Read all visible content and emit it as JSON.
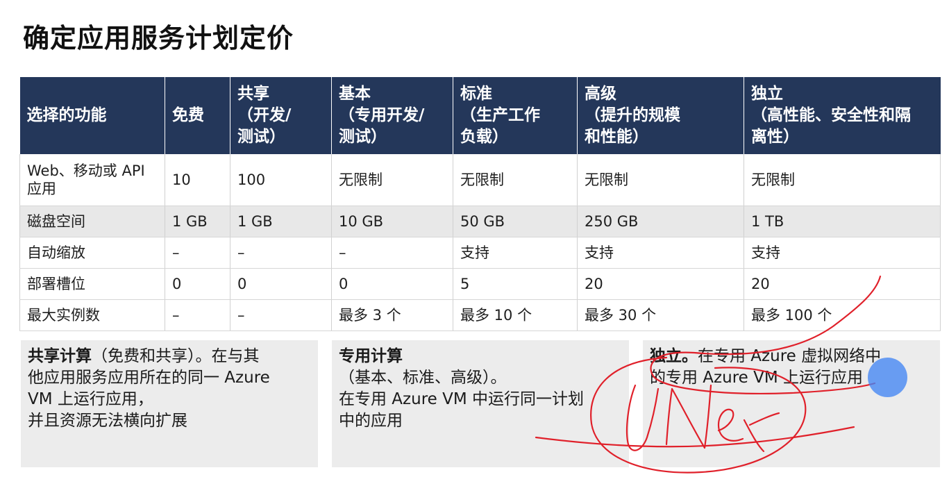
{
  "title": "确定应用服务计划定价",
  "table": {
    "headers": [
      [
        "选择的功能"
      ],
      [
        "免费"
      ],
      [
        "共享",
        "（开发/",
        "测试）"
      ],
      [
        "基本",
        "（专用开发/",
        "测试）"
      ],
      [
        "标准",
        "（生产工作",
        "负载）"
      ],
      [
        "高级",
        "（提升的规模",
        "和性能）"
      ],
      [
        "独立",
        "（高性能、安全性和隔",
        "离性）"
      ]
    ],
    "rows": [
      [
        [
          "Web、移动或 API",
          "应用"
        ],
        [
          "10"
        ],
        [
          "100"
        ],
        [
          "无限制"
        ],
        [
          "无限制"
        ],
        [
          "无限制"
        ],
        [
          "无限制"
        ]
      ],
      [
        [
          "磁盘空间"
        ],
        [
          "1 GB"
        ],
        [
          "1 GB"
        ],
        [
          "10 GB"
        ],
        [
          "50 GB"
        ],
        [
          "250 GB"
        ],
        [
          "1 TB"
        ]
      ],
      [
        [
          "自动缩放"
        ],
        [
          "–"
        ],
        [
          "–"
        ],
        [
          "–"
        ],
        [
          "支持"
        ],
        [
          "支持"
        ],
        [
          "支持"
        ]
      ],
      [
        [
          "部署槽位"
        ],
        [
          "0"
        ],
        [
          "0"
        ],
        [
          "0"
        ],
        [
          "5"
        ],
        [
          "20"
        ],
        [
          "20"
        ]
      ],
      [
        [
          "最大实例数"
        ],
        [
          "–"
        ],
        [
          "–"
        ],
        [
          "最多 3 个"
        ],
        [
          "最多 10 个"
        ],
        [
          "最多 30 个"
        ],
        [
          "最多 100 个"
        ]
      ]
    ]
  },
  "boxes": {
    "shared": {
      "bold": "共享计算",
      "lines": [
        "（免费和共享）。在与其",
        "他应用服务应用所在的同一 Azure",
        "VM 上运行应用，",
        "并且资源无法横向扩展"
      ]
    },
    "dedicated": {
      "bold": "专用计算",
      "lines": [
        "（基本、标准、高级）。",
        "在专用 Azure VM 中运行同一计划",
        "中的应用"
      ]
    },
    "isolated": {
      "bold": "独立。",
      "lines": [
        "在专用 Azure 虚拟网络中",
        "的专用 Azure VM 上运行应用"
      ]
    }
  },
  "colors": {
    "header_bg": "#24375a",
    "alt_row_bg": "#e8e8e8",
    "box_bg": "#ececec",
    "ink": "#e0202a",
    "cursor": "#4285f4"
  }
}
